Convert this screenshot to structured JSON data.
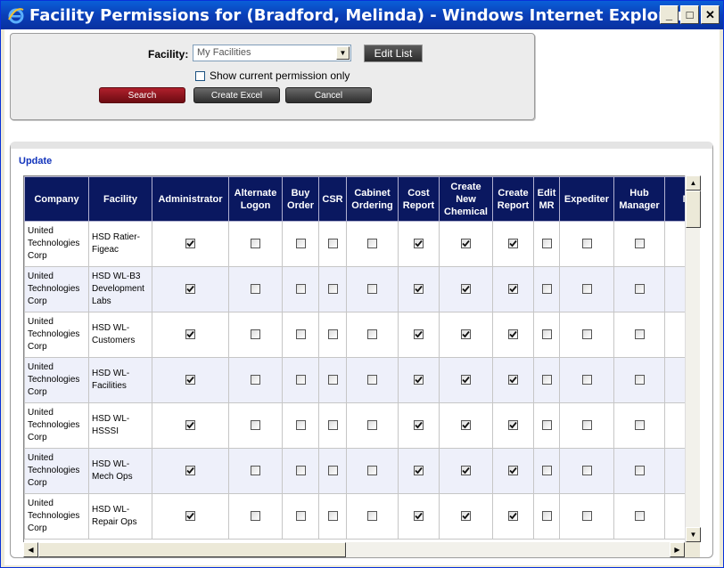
{
  "window": {
    "title": "Facility Permissions for (Bradford, Melinda) - Windows Internet Explorer",
    "minimize": "_",
    "maximize": "□",
    "close": "✕"
  },
  "search": {
    "facility_label": "Facility:",
    "facility_value": "My Facilities",
    "edit_list": "Edit List",
    "show_current_label": "Show current permission only",
    "show_current_checked": false,
    "search_button": "Search",
    "excel_button": "Create Excel",
    "cancel_button": "Cancel"
  },
  "results": {
    "update_link": "Update",
    "columns": [
      "Company",
      "Facility",
      "Administrator",
      "Alternate Logon",
      "Buy Order",
      "CSR",
      "Cabinet Ordering",
      "Cost Report",
      "Create New Chemical",
      "Create Report",
      "Edit MR",
      "Expediter",
      "Hub Manager",
      "MR Release"
    ],
    "rows": [
      {
        "company": "United Technologies Corp",
        "facility": "HSD Ratier-Figeac",
        "perms": [
          true,
          false,
          false,
          false,
          false,
          true,
          true,
          true,
          false,
          false,
          false,
          false
        ]
      },
      {
        "company": "United Technologies Corp",
        "facility": "HSD WL-B3 Development Labs",
        "perms": [
          true,
          false,
          false,
          false,
          false,
          true,
          true,
          true,
          false,
          false,
          false,
          false
        ]
      },
      {
        "company": "United Technologies Corp",
        "facility": "HSD WL-Customers",
        "perms": [
          true,
          false,
          false,
          false,
          false,
          true,
          true,
          true,
          false,
          false,
          false,
          false
        ]
      },
      {
        "company": "United Technologies Corp",
        "facility": "HSD WL-Facilities",
        "perms": [
          true,
          false,
          false,
          false,
          false,
          true,
          true,
          true,
          false,
          false,
          false,
          false
        ]
      },
      {
        "company": "United Technologies Corp",
        "facility": "HSD WL-HSSSI",
        "perms": [
          true,
          false,
          false,
          false,
          false,
          true,
          true,
          true,
          false,
          false,
          false,
          false
        ]
      },
      {
        "company": "United Technologies Corp",
        "facility": "HSD WL-Mech Ops",
        "perms": [
          true,
          false,
          false,
          false,
          false,
          true,
          true,
          true,
          false,
          false,
          false,
          false
        ]
      },
      {
        "company": "United Technologies Corp",
        "facility": "HSD WL-Repair Ops",
        "perms": [
          true,
          false,
          false,
          false,
          false,
          true,
          true,
          true,
          false,
          false,
          false,
          false
        ]
      }
    ]
  }
}
